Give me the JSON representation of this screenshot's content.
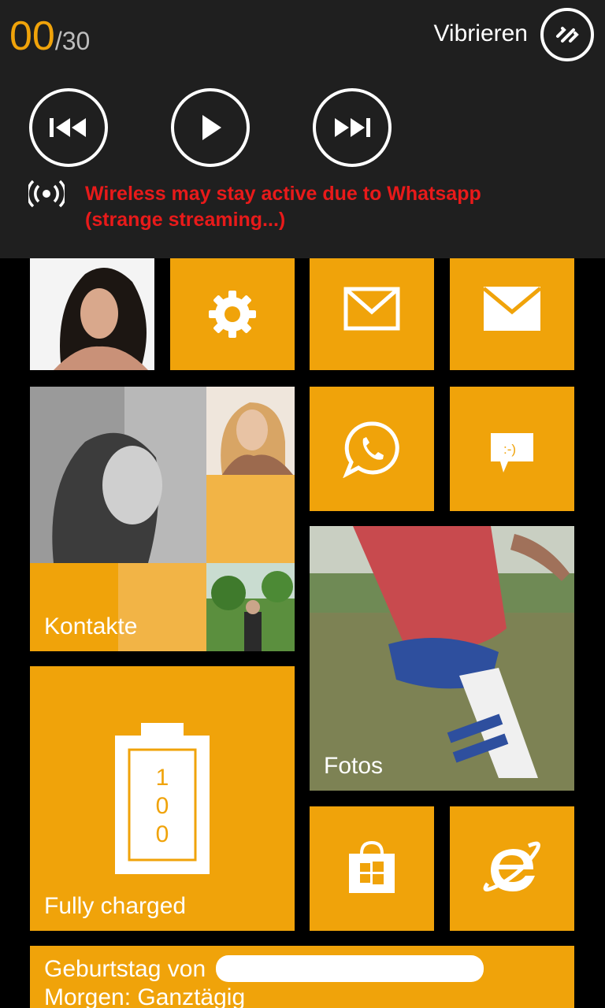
{
  "volume": {
    "current": "00",
    "max": "/30"
  },
  "vibrate": {
    "label": "Vibrieren"
  },
  "media": {
    "prev_icon": "skip-previous-icon",
    "play_icon": "play-icon",
    "next_icon": "skip-next-icon"
  },
  "notice": {
    "icon": "wireless-icon",
    "line1": "Wireless may stay active due to Whatsapp",
    "line2": "(strange streaming...)",
    "color": "#e81a1a"
  },
  "colors": {
    "accent": "#f0a30a",
    "panel": "#1f1f1f",
    "background": "#000000"
  },
  "tiles": {
    "contacts": {
      "label": "Kontakte"
    },
    "photos": {
      "label": "Fotos"
    },
    "battery": {
      "label": "Fully charged",
      "level_digits": [
        "1",
        "0",
        "0"
      ]
    },
    "calendar": {
      "line1": "Geburtstag von",
      "line2": "Morgen: Ganztägig"
    },
    "settings_icon": "gear-icon",
    "mail_icon": "mail-icon",
    "whatsapp_icon": "whatsapp-icon",
    "messaging_icon": "messaging-icon",
    "store_icon": "store-icon",
    "ie_icon": "internet-explorer-icon"
  }
}
